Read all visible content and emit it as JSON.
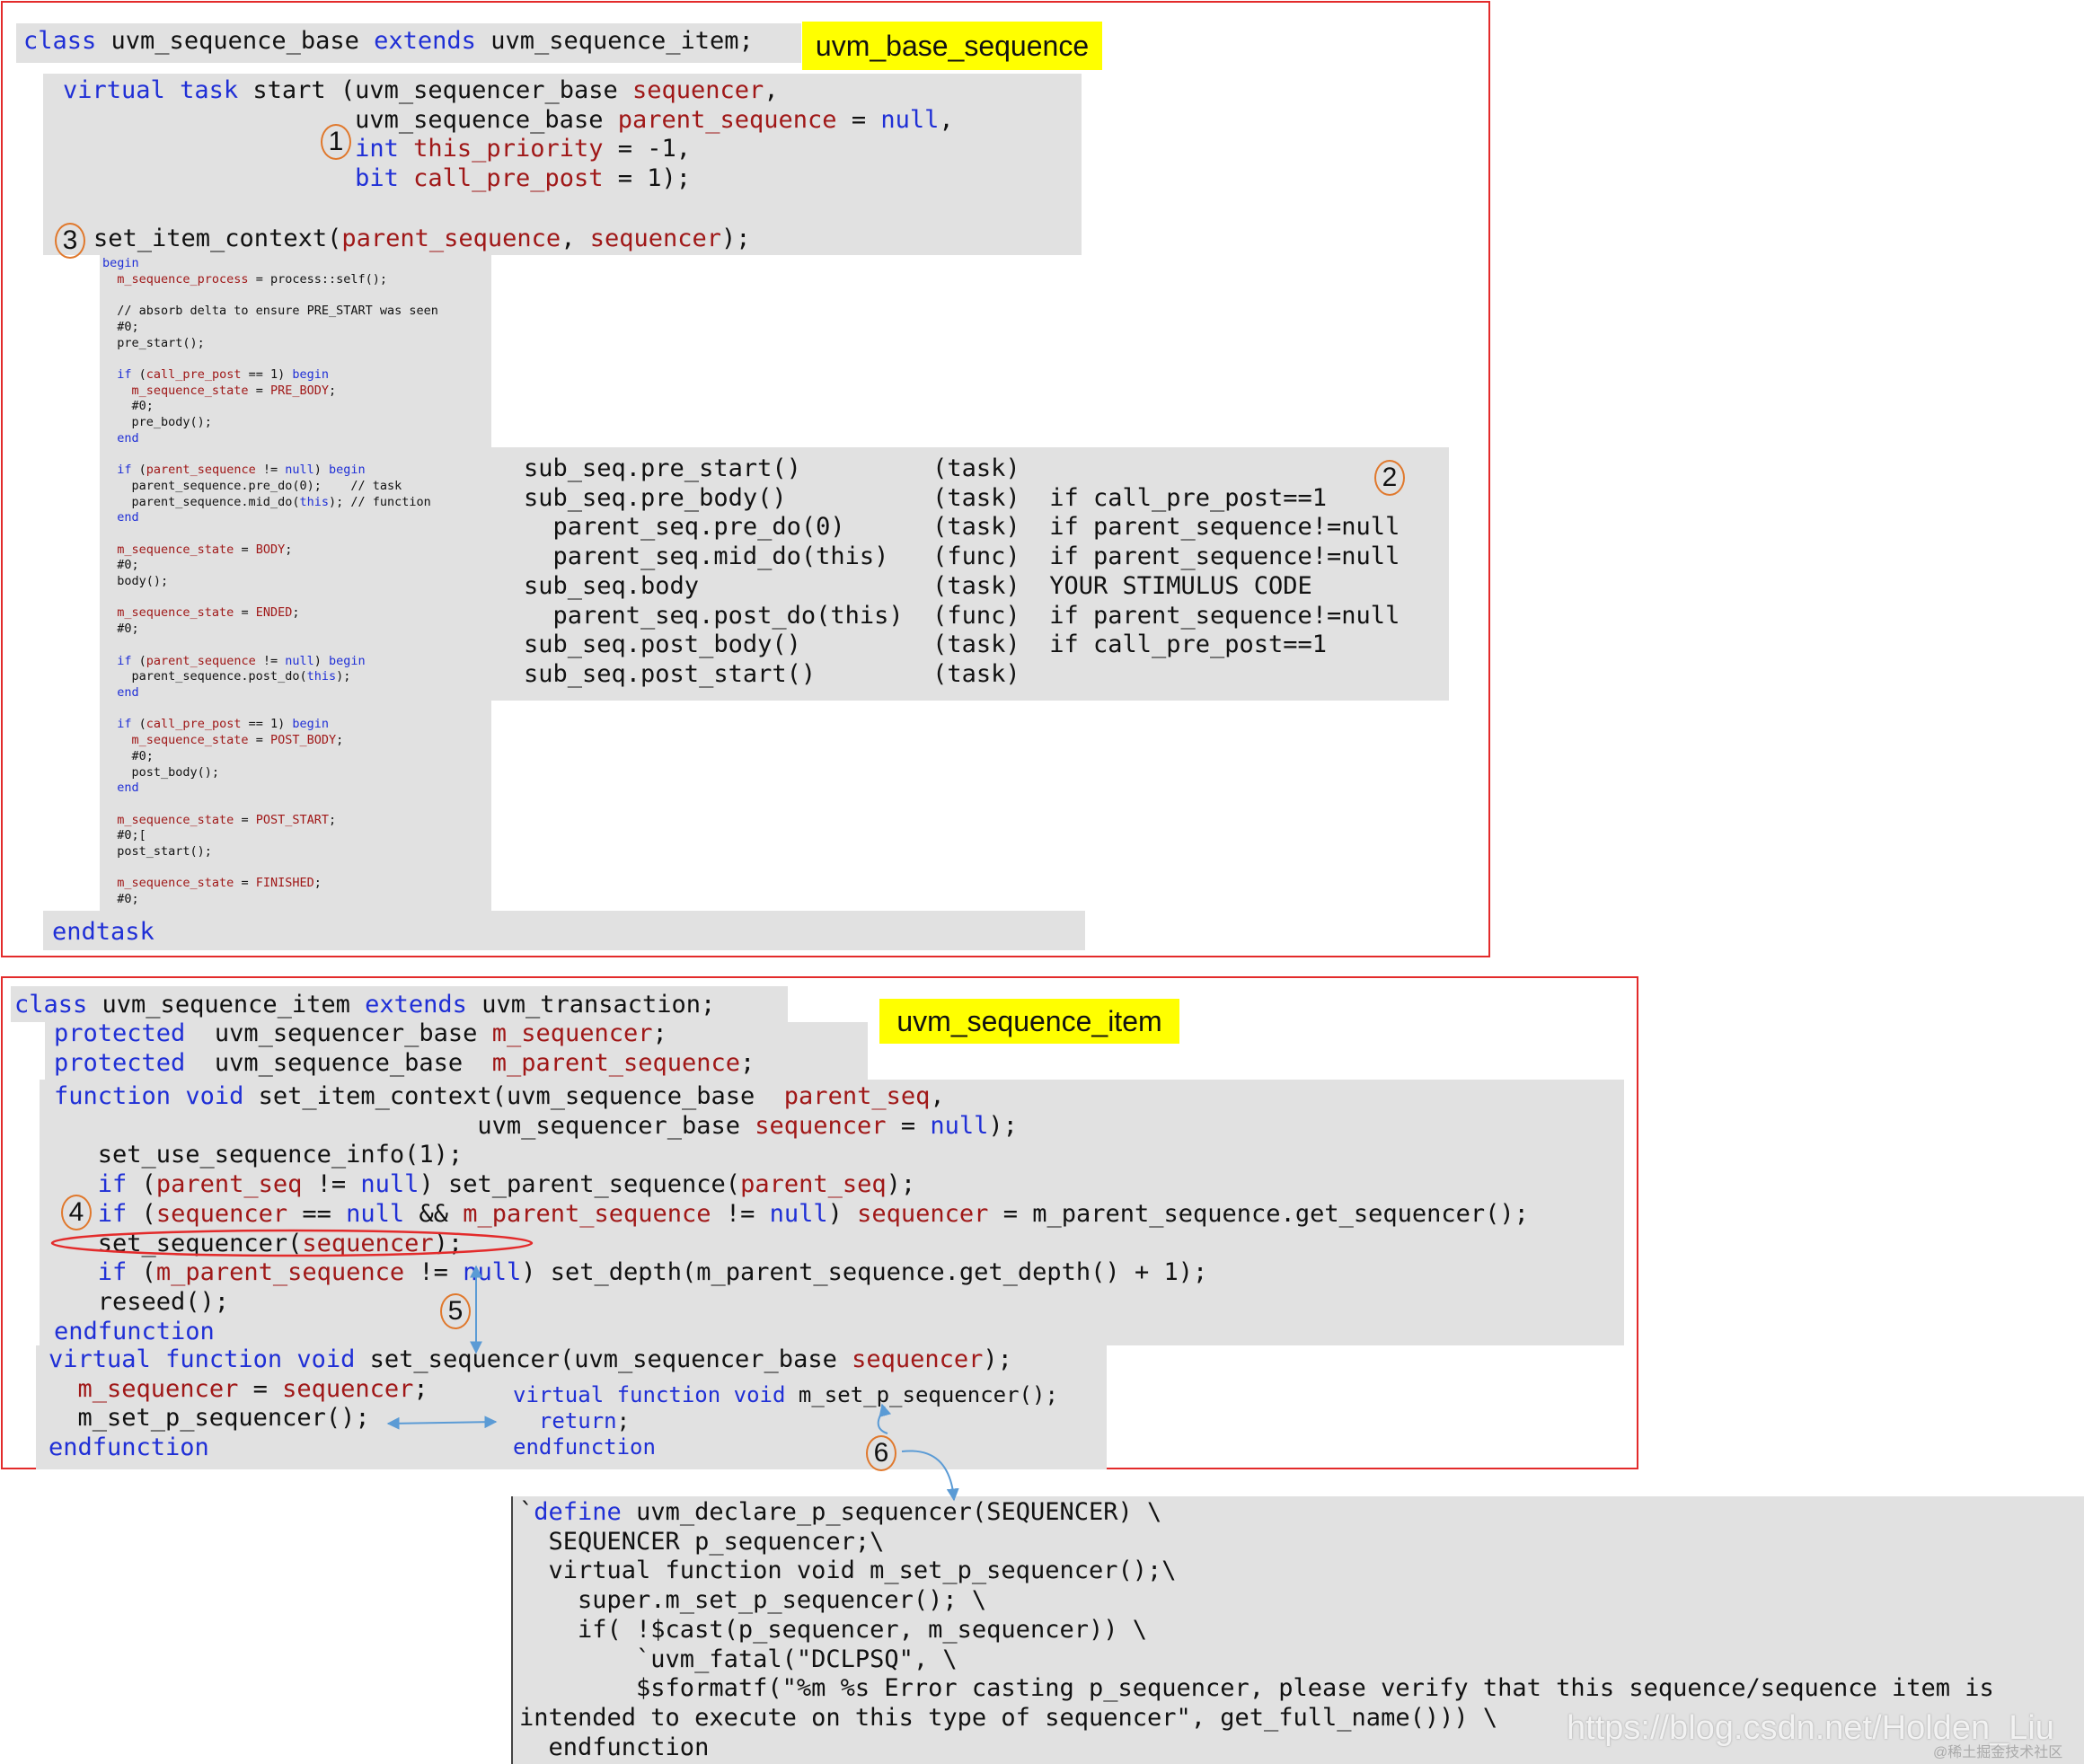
{
  "top_section": {
    "class_line": [
      {
        "t": "class",
        "c": "kw"
      },
      {
        "t": " uvm_sequence_base "
      },
      {
        "t": "extends",
        "c": "kw"
      },
      {
        "t": " uvm_sequence_item;"
      }
    ],
    "tag": "uvm_base_sequence",
    "start_lines": [
      [
        {
          "t": "virtual",
          "c": "kw"
        },
        {
          "t": " "
        },
        {
          "t": "task",
          "c": "kw"
        },
        {
          "t": " start (uvm_sequencer_base "
        },
        {
          "t": "sequencer",
          "c": "vr"
        },
        {
          "t": ","
        }
      ],
      [
        {
          "t": "                    uvm_sequence_base "
        },
        {
          "t": "parent_sequence",
          "c": "vr"
        },
        {
          "t": " = "
        },
        {
          "t": "null",
          "c": "kw"
        },
        {
          "t": ","
        }
      ],
      [
        {
          "t": "                    "
        },
        {
          "t": "int",
          "c": "kw"
        },
        {
          "t": " "
        },
        {
          "t": "this_priority",
          "c": "vr"
        },
        {
          "t": " = -1,"
        }
      ],
      [
        {
          "t": "                    "
        },
        {
          "t": "bit",
          "c": "kw"
        },
        {
          "t": " "
        },
        {
          "t": "call_pre_post",
          "c": "vr"
        },
        {
          "t": " = 1);"
        }
      ]
    ],
    "set_ctx_line": [
      {
        "t": "set_item_context("
      },
      {
        "t": "parent_sequence",
        "c": "vr"
      },
      {
        "t": ", "
      },
      {
        "t": "sequencer",
        "c": "vr"
      },
      {
        "t": ");"
      }
    ],
    "body_lines": [
      [
        {
          "t": "begin",
          "c": "kw"
        }
      ],
      [
        {
          "t": "  "
        },
        {
          "t": "m_sequence_process",
          "c": "vr"
        },
        {
          "t": " = process::self();"
        }
      ],
      [
        {
          "t": ""
        }
      ],
      [
        {
          "t": "  // absorb delta to ensure PRE_START was seen"
        }
      ],
      [
        {
          "t": "  #0;"
        }
      ],
      [
        {
          "t": "  pre_start();"
        }
      ],
      [
        {
          "t": ""
        }
      ],
      [
        {
          "t": "  "
        },
        {
          "t": "if",
          "c": "kw"
        },
        {
          "t": " ("
        },
        {
          "t": "call_pre_post",
          "c": "vr"
        },
        {
          "t": " == 1) "
        },
        {
          "t": "begin",
          "c": "kw"
        }
      ],
      [
        {
          "t": "    "
        },
        {
          "t": "m_sequence_state",
          "c": "vr"
        },
        {
          "t": " = "
        },
        {
          "t": "PRE_BODY",
          "c": "vr"
        },
        {
          "t": ";"
        }
      ],
      [
        {
          "t": "    #0;"
        }
      ],
      [
        {
          "t": "    pre_body();"
        }
      ],
      [
        {
          "t": "  "
        },
        {
          "t": "end",
          "c": "kw"
        }
      ],
      [
        {
          "t": ""
        }
      ],
      [
        {
          "t": "  "
        },
        {
          "t": "if",
          "c": "kw"
        },
        {
          "t": " ("
        },
        {
          "t": "parent_sequence",
          "c": "vr"
        },
        {
          "t": " != "
        },
        {
          "t": "null",
          "c": "kw"
        },
        {
          "t": ") "
        },
        {
          "t": "begin",
          "c": "kw"
        }
      ],
      [
        {
          "t": "    parent_sequence.pre_do(0);    // task"
        }
      ],
      [
        {
          "t": "    parent_sequence.mid_do("
        },
        {
          "t": "this",
          "c": "kw"
        },
        {
          "t": "); // function"
        }
      ],
      [
        {
          "t": "  "
        },
        {
          "t": "end",
          "c": "kw"
        }
      ],
      [
        {
          "t": ""
        }
      ],
      [
        {
          "t": "  "
        },
        {
          "t": "m_sequence_state",
          "c": "vr"
        },
        {
          "t": " = "
        },
        {
          "t": "BODY",
          "c": "vr"
        },
        {
          "t": ";"
        }
      ],
      [
        {
          "t": "  #0;"
        }
      ],
      [
        {
          "t": "  body();"
        }
      ],
      [
        {
          "t": ""
        }
      ],
      [
        {
          "t": "  "
        },
        {
          "t": "m_sequence_state",
          "c": "vr"
        },
        {
          "t": " = "
        },
        {
          "t": "ENDED",
          "c": "vr"
        },
        {
          "t": ";"
        }
      ],
      [
        {
          "t": "  #0;"
        }
      ],
      [
        {
          "t": ""
        }
      ],
      [
        {
          "t": "  "
        },
        {
          "t": "if",
          "c": "kw"
        },
        {
          "t": " ("
        },
        {
          "t": "parent_sequence",
          "c": "vr"
        },
        {
          "t": " != "
        },
        {
          "t": "null",
          "c": "kw"
        },
        {
          "t": ") "
        },
        {
          "t": "begin",
          "c": "kw"
        }
      ],
      [
        {
          "t": "    parent_sequence.post_do("
        },
        {
          "t": "this",
          "c": "kw"
        },
        {
          "t": ");"
        }
      ],
      [
        {
          "t": "  "
        },
        {
          "t": "end",
          "c": "kw"
        }
      ],
      [
        {
          "t": ""
        }
      ],
      [
        {
          "t": "  "
        },
        {
          "t": "if",
          "c": "kw"
        },
        {
          "t": " ("
        },
        {
          "t": "call_pre_post",
          "c": "vr"
        },
        {
          "t": " == 1) "
        },
        {
          "t": "begin",
          "c": "kw"
        }
      ],
      [
        {
          "t": "    "
        },
        {
          "t": "m_sequence_state",
          "c": "vr"
        },
        {
          "t": " = "
        },
        {
          "t": "POST_BODY",
          "c": "vr"
        },
        {
          "t": ";"
        }
      ],
      [
        {
          "t": "    #0;"
        }
      ],
      [
        {
          "t": "    post_body();"
        }
      ],
      [
        {
          "t": "  "
        },
        {
          "t": "end",
          "c": "kw"
        }
      ],
      [
        {
          "t": ""
        }
      ],
      [
        {
          "t": "  "
        },
        {
          "t": "m_sequence_state",
          "c": "vr"
        },
        {
          "t": " = "
        },
        {
          "t": "POST_START",
          "c": "vr"
        },
        {
          "t": ";"
        }
      ],
      [
        {
          "t": "  #0;["
        }
      ],
      [
        {
          "t": "  post_start();"
        }
      ],
      [
        {
          "t": ""
        }
      ],
      [
        {
          "t": "  "
        },
        {
          "t": "m_sequence_state",
          "c": "vr"
        },
        {
          "t": " = "
        },
        {
          "t": "FINISHED",
          "c": "vr"
        },
        {
          "t": ";"
        }
      ],
      [
        {
          "t": "  #0;"
        }
      ]
    ],
    "endtask": [
      {
        "t": "endtask",
        "c": "kw"
      }
    ],
    "flow_lines": [
      [
        {
          "t": "sub_seq.pre_start()         (task)"
        }
      ],
      [
        {
          "t": "sub_seq.pre_body()          (task)  if call_pre_post==1"
        }
      ],
      [
        {
          "t": "  parent_seq.pre_do(0)      (task)  if parent_sequence!=null"
        }
      ],
      [
        {
          "t": "  parent_seq.mid_do(this)   (func)  if parent_sequence!=null"
        }
      ],
      [
        {
          "t": "sub_seq.body                (task)  YOUR STIMULUS CODE"
        }
      ],
      [
        {
          "t": "  parent_seq.post_do(this)  (func)  if parent_sequence!=null"
        }
      ],
      [
        {
          "t": "sub_seq.post_body()         (task)  if call_pre_post==1"
        }
      ],
      [
        {
          "t": "sub_seq.post_start()        (task)"
        }
      ]
    ]
  },
  "item_section": {
    "tag": "uvm_sequence_item",
    "class_lines": [
      [
        {
          "t": "class",
          "c": "kw"
        },
        {
          "t": " uvm_sequence_item "
        },
        {
          "t": "extends",
          "c": "kw"
        },
        {
          "t": " uvm_transaction;"
        }
      ]
    ],
    "member_lines": [
      [
        {
          "t": "protected",
          "c": "kw"
        },
        {
          "t": "  uvm_sequencer_base "
        },
        {
          "t": "m_sequencer",
          "c": "vr"
        },
        {
          "t": ";"
        }
      ],
      [
        {
          "t": "protected",
          "c": "kw"
        },
        {
          "t": "  uvm_sequence_base  "
        },
        {
          "t": "m_parent_sequence",
          "c": "vr"
        },
        {
          "t": ";"
        }
      ]
    ],
    "func_lines": [
      [
        {
          "t": "function",
          "c": "kw"
        },
        {
          "t": " "
        },
        {
          "t": "void",
          "c": "kw"
        },
        {
          "t": " set_item_context(uvm_sequence_base  "
        },
        {
          "t": "parent_seq",
          "c": "vr"
        },
        {
          "t": ","
        }
      ],
      [
        {
          "t": "                             uvm_sequencer_base "
        },
        {
          "t": "sequencer",
          "c": "vr"
        },
        {
          "t": " = "
        },
        {
          "t": "null",
          "c": "kw"
        },
        {
          "t": ");"
        }
      ],
      [
        {
          "t": "   set_use_sequence_info(1);"
        }
      ],
      [
        {
          "t": "   "
        },
        {
          "t": "if",
          "c": "kw"
        },
        {
          "t": " ("
        },
        {
          "t": "parent_seq",
          "c": "vr"
        },
        {
          "t": " != "
        },
        {
          "t": "null",
          "c": "kw"
        },
        {
          "t": ") set_parent_sequence("
        },
        {
          "t": "parent_seq",
          "c": "vr"
        },
        {
          "t": ");"
        }
      ],
      [
        {
          "t": "   "
        },
        {
          "t": "if",
          "c": "kw"
        },
        {
          "t": " ("
        },
        {
          "t": "sequencer",
          "c": "vr"
        },
        {
          "t": " == "
        },
        {
          "t": "null",
          "c": "kw"
        },
        {
          "t": " && "
        },
        {
          "t": "m_parent_sequence",
          "c": "vr"
        },
        {
          "t": " != "
        },
        {
          "t": "null",
          "c": "kw"
        },
        {
          "t": ") "
        },
        {
          "t": "sequencer",
          "c": "vr"
        },
        {
          "t": " = m_parent_sequence.get_sequencer();"
        }
      ],
      [
        {
          "t": "   set_sequencer("
        },
        {
          "t": "sequencer",
          "c": "vr"
        },
        {
          "t": ");"
        }
      ],
      [
        {
          "t": "   "
        },
        {
          "t": "if",
          "c": "kw"
        },
        {
          "t": " ("
        },
        {
          "t": "m_parent_sequence",
          "c": "vr"
        },
        {
          "t": " != "
        },
        {
          "t": "null",
          "c": "kw"
        },
        {
          "t": ") set_depth(m_parent_sequence.get_depth() + 1);"
        }
      ],
      [
        {
          "t": "   reseed();"
        }
      ],
      [
        {
          "t": "endfunction",
          "c": "kw"
        }
      ]
    ],
    "virt_lines": [
      [
        {
          "t": "virtual",
          "c": "kw"
        },
        {
          "t": " "
        },
        {
          "t": "function",
          "c": "kw"
        },
        {
          "t": " "
        },
        {
          "t": "void",
          "c": "kw"
        },
        {
          "t": " set_sequencer(uvm_sequencer_base "
        },
        {
          "t": "sequencer",
          "c": "vr"
        },
        {
          "t": ");"
        }
      ],
      [
        {
          "t": "  "
        },
        {
          "t": "m_sequencer",
          "c": "vr"
        },
        {
          "t": " = "
        },
        {
          "t": "sequencer",
          "c": "vr"
        },
        {
          "t": ";"
        }
      ],
      [
        {
          "t": "  m_set_p_sequencer();"
        }
      ],
      [
        {
          "t": "endfunction",
          "c": "kw"
        }
      ]
    ],
    "m_set_lines": [
      [
        {
          "t": "virtual",
          "c": "kw"
        },
        {
          "t": " "
        },
        {
          "t": "function",
          "c": "kw"
        },
        {
          "t": " "
        },
        {
          "t": "void",
          "c": "kw"
        },
        {
          "t": " m_set_p_sequencer();"
        }
      ],
      [
        {
          "t": "  "
        },
        {
          "t": "return",
          "c": "kw"
        },
        {
          "t": ";"
        }
      ],
      [
        {
          "t": "endfunction",
          "c": "kw"
        }
      ]
    ]
  },
  "macro_section": {
    "lines": [
      [
        {
          "t": "`"
        },
        {
          "t": "define",
          "c": "kw"
        },
        {
          "t": " uvm_declare_p_sequencer(SEQUENCER) \\"
        }
      ],
      [
        {
          "t": "  SEQUENCER p_sequencer;\\"
        }
      ],
      [
        {
          "t": "  virtual function void m_set_p_sequencer();\\"
        }
      ],
      [
        {
          "t": "    super.m_set_p_sequencer(); \\"
        }
      ],
      [
        {
          "t": "    if( !$cast(p_sequencer, m_sequencer)) \\"
        }
      ],
      [
        {
          "t": "        `uvm_fatal(\"DCLPSQ\", \\"
        }
      ],
      [
        {
          "t": "        $sformatf(\"%m %s Error casting p_sequencer, please verify that this sequence/sequence item is"
        }
      ],
      [
        {
          "t": "intended to execute on this type of sequencer\", get_full_name())) \\"
        }
      ],
      [
        {
          "t": "  endfunction"
        }
      ]
    ]
  },
  "markers": {
    "m1": "1",
    "m2": "2",
    "m3": "3",
    "m4": "4",
    "m5": "5",
    "m6": "6"
  },
  "watermark": {
    "url": "https://blog.csdn.net/Holden_Liu",
    "small": "@稀土掘金技术社区"
  },
  "colors": {
    "frame": "#e32b2b",
    "keyword": "#1f2fd6",
    "variable": "#a01818",
    "code_bg": "#e1e1e1",
    "tag_bg": "#ffff00",
    "marker": "#e0782c",
    "arrow": "#5b9bd5",
    "ellipse": "#e32b2b"
  }
}
